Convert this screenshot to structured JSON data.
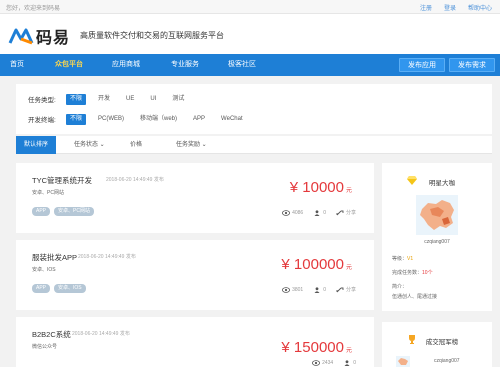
{
  "topbar": {
    "welcome": "您好，欢迎来到码易",
    "links": [
      "注册",
      "登录",
      "帮助中心"
    ]
  },
  "header": {
    "logo_text": "码易",
    "slogan": "高质量软件交付和交易的互联网服务平台"
  },
  "nav": {
    "items": [
      "首页",
      "众包平台",
      "应用商城",
      "专业服务",
      "极客社区"
    ],
    "active": "众包平台",
    "buttons": [
      "发布应用",
      "发布需求"
    ]
  },
  "filter": {
    "task_type_label": "任务类型:",
    "task_types": [
      "不限",
      "开发",
      "UE",
      "UI",
      "测试"
    ],
    "platform_label": "开发终端:",
    "platforms": [
      "不限",
      "PC(WEB)",
      "移动端（web)",
      "APP",
      "WeChat"
    ]
  },
  "sortbar": {
    "items": [
      "默认排序",
      "任务状态 ⌄",
      "价格",
      "任务奖励 ⌄"
    ]
  },
  "cards": [
    {
      "title": "TYC管理系统开发",
      "date": "2018-06-20 14:49:49 发布",
      "meta": "安卓、PC网站",
      "price": "¥ 10000",
      "unit": "元",
      "tags": [
        "APP",
        "安卓、PC网站"
      ],
      "views": "4086",
      "bids": "0",
      "share": "分享"
    },
    {
      "title": "服装批发APP",
      "date": "2018-06-20 14:49:49 发布",
      "meta": "安卓、IOS",
      "price": "¥ 100000",
      "unit": "元",
      "tags": [
        "APP",
        "安卓、IOS"
      ],
      "views": "3801",
      "bids": "0",
      "share": "分享"
    },
    {
      "title": "B2B2C系统",
      "date": "2018-06-20 14:49:49 发布",
      "meta": "微信公众号",
      "price": "¥ 150000",
      "unit": "元",
      "tags": [],
      "views": "2434",
      "bids": "0",
      "share": ""
    }
  ],
  "star_panel": {
    "title": "明星大咖",
    "username": "czqiang007",
    "level_label": "等级：",
    "level_value": "V1",
    "tasks_label": "完成任务数：",
    "tasks_value": "10个",
    "profile_label": "简介：",
    "profile_text": "伍通创人、尾通过接"
  },
  "rank_panel": {
    "title": "成交冠军榜",
    "username": "czqiang007"
  },
  "colors": {
    "primary": "#1e7fd6",
    "price": "#e4393c",
    "highlight": "#ffd84d"
  }
}
